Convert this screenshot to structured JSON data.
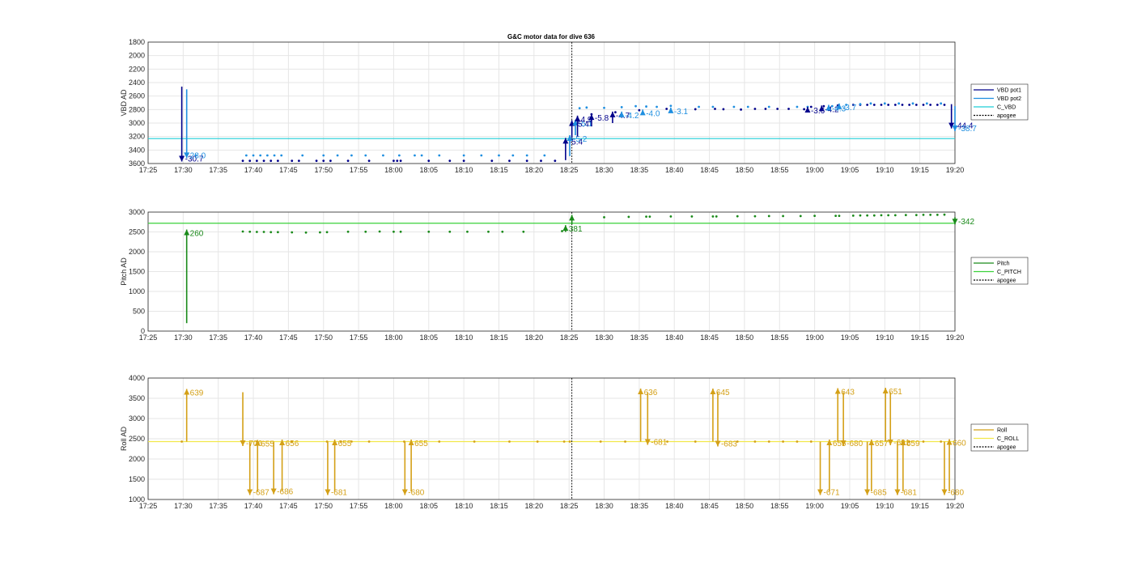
{
  "chart_data": [
    {
      "type": "line",
      "title": "G&C motor data for dive 636",
      "ylabel": "VBD AD",
      "ylim": [
        3600,
        1800
      ],
      "y_reversed": true,
      "yticks": [
        "1800",
        "2000",
        "2200",
        "2400",
        "2600",
        "2800",
        "3000",
        "3200",
        "3400",
        "3600"
      ],
      "xticks": [
        "17:25",
        "17:30",
        "17:35",
        "17:40",
        "17:45",
        "17:50",
        "17:55",
        "18:00",
        "18:05",
        "18:10",
        "18:15",
        "18:20",
        "18:25",
        "18:30",
        "18:35",
        "18:40",
        "18:45",
        "18:50",
        "18:55",
        "19:00",
        "19:05",
        "19:10",
        "19:15",
        "19:20"
      ],
      "xlim_minutes": [
        0,
        115
      ],
      "grid": true,
      "legend_position": "right",
      "legend": [
        {
          "label": "VBD pot1",
          "color": "#00008b",
          "style": "solid"
        },
        {
          "label": "VBD pot2",
          "color": "#1f8fe0",
          "style": "solid"
        },
        {
          "label": "C_VBD",
          "color": "#1fcfd8",
          "style": "solid"
        },
        {
          "label": "apogee",
          "color": "#000000",
          "style": "dotted"
        }
      ],
      "apogee_minute": 60.4,
      "c_value": 3230,
      "pot1_points": [
        [
          13.5,
          3560
        ],
        [
          14.5,
          3560
        ],
        [
          15.5,
          3560
        ],
        [
          16.5,
          3560
        ],
        [
          17.5,
          3560
        ],
        [
          18.5,
          3560
        ],
        [
          20.5,
          3560
        ],
        [
          21.5,
          3560
        ],
        [
          24,
          3560
        ],
        [
          25,
          3560
        ],
        [
          26,
          3560
        ],
        [
          28.5,
          3560
        ],
        [
          31.5,
          3560
        ],
        [
          35,
          3560
        ],
        [
          35.5,
          3560
        ],
        [
          36,
          3560
        ],
        [
          40,
          3560
        ],
        [
          43,
          3560
        ],
        [
          45,
          3560
        ],
        [
          49,
          3560
        ],
        [
          51.5,
          3560
        ],
        [
          54,
          3560
        ],
        [
          56,
          3560
        ],
        [
          58,
          3560
        ],
        [
          63.2,
          2870
        ],
        [
          66.6,
          2840
        ],
        [
          70,
          2810
        ],
        [
          73.9,
          2790
        ],
        [
          78,
          2795
        ],
        [
          80.8,
          2790
        ],
        [
          82,
          2795
        ],
        [
          84.5,
          2800
        ],
        [
          86.5,
          2790
        ],
        [
          88,
          2790
        ],
        [
          89.7,
          2790
        ],
        [
          91.3,
          2790
        ],
        [
          93.5,
          2795
        ],
        [
          94.5,
          2760
        ],
        [
          96.3,
          2750
        ],
        [
          98.3,
          2740
        ],
        [
          100.5,
          2730
        ],
        [
          101.5,
          2730
        ],
        [
          102.5,
          2730
        ],
        [
          103.5,
          2730
        ],
        [
          104.5,
          2730
        ],
        [
          105.5,
          2730
        ],
        [
          106.5,
          2730
        ],
        [
          107.5,
          2730
        ],
        [
          108.5,
          2730
        ],
        [
          109.5,
          2730
        ],
        [
          110.5,
          2730
        ],
        [
          111.5,
          2730
        ],
        [
          112.5,
          2730
        ],
        [
          113.5,
          2730
        ]
      ],
      "pot2_points": [
        [
          6.8,
          3480
        ],
        [
          14,
          3480
        ],
        [
          15,
          3480
        ],
        [
          16,
          3480
        ],
        [
          17,
          3480
        ],
        [
          18,
          3480
        ],
        [
          19,
          3480
        ],
        [
          22,
          3480
        ],
        [
          25,
          3480
        ],
        [
          27,
          3480
        ],
        [
          29,
          3480
        ],
        [
          31,
          3480
        ],
        [
          33.5,
          3480
        ],
        [
          35.8,
          3480
        ],
        [
          38,
          3480
        ],
        [
          39,
          3480
        ],
        [
          41.5,
          3480
        ],
        [
          45,
          3480
        ],
        [
          47.5,
          3480
        ],
        [
          50,
          3480
        ],
        [
          52,
          3480
        ],
        [
          54,
          3480
        ],
        [
          56.5,
          3480
        ],
        [
          61.5,
          2780
        ],
        [
          62.5,
          2770
        ],
        [
          65,
          2775
        ],
        [
          67.5,
          2765
        ],
        [
          69.5,
          2750
        ],
        [
          71,
          2755
        ],
        [
          72.5,
          2760
        ],
        [
          74.5,
          2745
        ],
        [
          78.5,
          2760
        ],
        [
          80.5,
          2760
        ],
        [
          83.5,
          2760
        ],
        [
          85.5,
          2760
        ],
        [
          88.5,
          2760
        ],
        [
          92.5,
          2760
        ],
        [
          94,
          2760
        ],
        [
          97.5,
          2750
        ],
        [
          99.5,
          2730
        ],
        [
          101.5,
          2720
        ],
        [
          103,
          2710
        ],
        [
          105,
          2710
        ],
        [
          107,
          2710
        ],
        [
          109,
          2710
        ],
        [
          111,
          2710
        ],
        [
          113,
          2710
        ]
      ],
      "arrows": [
        {
          "x": 4.8,
          "from": 2460,
          "to": 3570,
          "color": "#00008b",
          "label": "-30.7"
        },
        {
          "x": 5.5,
          "from": 2500,
          "to": 3520,
          "color": "#1f8fe0",
          "label": "28.0"
        },
        {
          "x": 59.5,
          "from": 3550,
          "to": 3220,
          "color": "#00008b",
          "label": "-5.4"
        },
        {
          "x": 60.1,
          "from": 3490,
          "to": 3180,
          "color": "#1f8fe0",
          "label": "-5.2"
        },
        {
          "x": 60.4,
          "from": 3220,
          "to": 2960,
          "color": "#00008b",
          "label": "-5.4"
        },
        {
          "x": 60.9,
          "from": 3180,
          "to": 2950,
          "color": "#1f8fe0",
          "label": "-5.1"
        },
        {
          "x": 61.2,
          "from": 3200,
          "to": 2890,
          "color": "#00008b",
          "label": "4.9"
        },
        {
          "x": 63.2,
          "from": 3050,
          "to": 2870,
          "color": "#00008b",
          "label": "-5.8"
        },
        {
          "x": 66.2,
          "from": 3000,
          "to": 2830,
          "color": "#00008b",
          "label": "-4.7"
        },
        {
          "x": 67.5,
          "from": 2860,
          "to": 2830,
          "color": "#1f8fe0",
          "label": "-4.2"
        },
        {
          "x": 70.5,
          "from": 2830,
          "to": 2800,
          "color": "#1f8fe0",
          "label": "-4.0"
        },
        {
          "x": 74.5,
          "from": 2810,
          "to": 2770,
          "color": "#1f8fe0",
          "label": "-3.1"
        },
        {
          "x": 94,
          "from": 2780,
          "to": 2760,
          "color": "#00008b",
          "label": "-3.6"
        },
        {
          "x": 96,
          "from": 2770,
          "to": 2740,
          "color": "#00008b",
          "label": "-4.2"
        },
        {
          "x": 97,
          "from": 2770,
          "to": 2730,
          "color": "#1f8fe0",
          "label": "-4.3"
        },
        {
          "x": 98.5,
          "from": 2760,
          "to": 2710,
          "color": "#1f8fe0",
          "label": "-3.7"
        },
        {
          "x": 114.5,
          "from": 2720,
          "to": 3080,
          "color": "#00008b",
          "label": "-44.4"
        },
        {
          "x": 115,
          "from": 2750,
          "to": 3120,
          "color": "#1f8fe0",
          "label": "-38.7"
        }
      ]
    },
    {
      "type": "line",
      "title": "",
      "ylabel": "Pitch AD",
      "ylim": [
        0,
        3000
      ],
      "yticks": [
        "0",
        "500",
        "1000",
        "1500",
        "2000",
        "2500",
        "3000"
      ],
      "xticks": [
        "17:25",
        "17:30",
        "17:35",
        "17:40",
        "17:45",
        "17:50",
        "17:55",
        "18:00",
        "18:05",
        "18:10",
        "18:15",
        "18:20",
        "18:25",
        "18:30",
        "18:35",
        "18:40",
        "18:45",
        "18:50",
        "18:55",
        "19:00",
        "19:05",
        "19:10",
        "19:15",
        "19:20"
      ],
      "xlim_minutes": [
        0,
        115
      ],
      "grid": true,
      "legend_position": "right",
      "legend": [
        {
          "label": "Pitch",
          "color": "#1a8a1a",
          "style": "solid"
        },
        {
          "label": "C_PITCH",
          "color": "#3ad13a",
          "style": "solid"
        },
        {
          "label": "apogee",
          "color": "#000000",
          "style": "dotted"
        }
      ],
      "apogee_minute": 60.4,
      "c_value": 2720,
      "points": [
        [
          13.5,
          2510
        ],
        [
          14.5,
          2505
        ],
        [
          15.5,
          2500
        ],
        [
          16.5,
          2500
        ],
        [
          17.5,
          2495
        ],
        [
          18.5,
          2495
        ],
        [
          20.5,
          2490
        ],
        [
          22.5,
          2485
        ],
        [
          24.5,
          2490
        ],
        [
          25.5,
          2495
        ],
        [
          28.5,
          2505
        ],
        [
          31,
          2505
        ],
        [
          33,
          2510
        ],
        [
          35,
          2505
        ],
        [
          36,
          2505
        ],
        [
          40,
          2505
        ],
        [
          43,
          2505
        ],
        [
          45.5,
          2505
        ],
        [
          48.5,
          2505
        ],
        [
          50.5,
          2505
        ],
        [
          53.5,
          2505
        ],
        [
          59,
          2520
        ],
        [
          65,
          2870
        ],
        [
          68.5,
          2880
        ],
        [
          71,
          2885
        ],
        [
          71.5,
          2885
        ],
        [
          74.5,
          2890
        ],
        [
          77.5,
          2890
        ],
        [
          80.5,
          2890
        ],
        [
          81,
          2890
        ],
        [
          84,
          2895
        ],
        [
          86.5,
          2895
        ],
        [
          88.5,
          2900
        ],
        [
          90.5,
          2900
        ],
        [
          93,
          2900
        ],
        [
          95,
          2905
        ],
        [
          98,
          2905
        ],
        [
          98.5,
          2905
        ],
        [
          100.5,
          2910
        ],
        [
          101.5,
          2915
        ],
        [
          102.5,
          2915
        ],
        [
          103.5,
          2915
        ],
        [
          104.5,
          2920
        ],
        [
          105.5,
          2920
        ],
        [
          106.5,
          2920
        ],
        [
          108,
          2925
        ],
        [
          109.5,
          2925
        ],
        [
          110.5,
          2930
        ],
        [
          111.5,
          2930
        ],
        [
          112.5,
          2930
        ],
        [
          113.5,
          2935
        ]
      ],
      "arrows": [
        {
          "x": 5.5,
          "from": 200,
          "to": 2560,
          "label": "260"
        },
        {
          "x": 59.5,
          "from": 2500,
          "to": 2670,
          "label": "381"
        },
        {
          "x": 60.4,
          "from": 2690,
          "to": 2930,
          "label": ""
        },
        {
          "x": 115,
          "from": 2870,
          "to": 2690,
          "label": "-342"
        }
      ]
    },
    {
      "type": "line",
      "title": "",
      "ylabel": "Roll AD",
      "ylim": [
        1000,
        4000
      ],
      "yticks": [
        "1000",
        "1500",
        "2000",
        "2500",
        "3000",
        "3500",
        "4000"
      ],
      "xticks": [
        "17:25",
        "17:30",
        "17:35",
        "17:40",
        "17:45",
        "17:50",
        "17:55",
        "18:00",
        "18:05",
        "18:10",
        "18:15",
        "18:20",
        "18:25",
        "18:30",
        "18:35",
        "18:40",
        "18:45",
        "18:50",
        "18:55",
        "19:00",
        "19:05",
        "19:10",
        "19:15",
        "19:20"
      ],
      "xlim_minutes": [
        0,
        115
      ],
      "grid": true,
      "legend_position": "right",
      "legend": [
        {
          "label": "Roll",
          "color": "#d4a017",
          "style": "solid"
        },
        {
          "label": "C_ROLL",
          "color": "#f2e84a",
          "style": "solid"
        },
        {
          "label": "apogee",
          "color": "#000000",
          "style": "dotted"
        }
      ],
      "apogee_minute": 60.4,
      "c_value": 2430,
      "points": [
        [
          4.8,
          2430
        ],
        [
          15.5,
          2430
        ],
        [
          20.5,
          2430
        ],
        [
          25.5,
          2430
        ],
        [
          27.5,
          2430
        ],
        [
          29,
          2430
        ],
        [
          31.5,
          2430
        ],
        [
          36.5,
          2430
        ],
        [
          41.5,
          2430
        ],
        [
          46.5,
          2430
        ],
        [
          51.5,
          2430
        ],
        [
          55.5,
          2430
        ],
        [
          59.3,
          2430
        ],
        [
          60.1,
          2430
        ],
        [
          64.5,
          2430
        ],
        [
          68,
          2430
        ],
        [
          74,
          2430
        ],
        [
          78,
          2430
        ],
        [
          84,
          2430
        ],
        [
          86.5,
          2430
        ],
        [
          88.5,
          2430
        ],
        [
          90.5,
          2430
        ],
        [
          92.5,
          2430
        ],
        [
          94.5,
          2430
        ],
        [
          108.5,
          2430
        ],
        [
          110.5,
          2430
        ],
        [
          113,
          2430
        ]
      ],
      "arrows": [
        {
          "x": 5.5,
          "from": 2430,
          "to": 3730,
          "label": "639"
        },
        {
          "x": 13.5,
          "from": 3650,
          "to": 2320,
          "label": "-706"
        },
        {
          "x": 14.5,
          "from": 2430,
          "to": 1110,
          "label": "-687"
        },
        {
          "x": 15.6,
          "from": 1200,
          "to": 2470,
          "label": "655"
        },
        {
          "x": 17.9,
          "from": 2430,
          "to": 1130,
          "label": "-686"
        },
        {
          "x": 19.1,
          "from": 1200,
          "to": 2480,
          "label": "656"
        },
        {
          "x": 25.6,
          "from": 2430,
          "to": 1110,
          "label": "-681"
        },
        {
          "x": 26.6,
          "from": 1200,
          "to": 2480,
          "label": "655"
        },
        {
          "x": 36.6,
          "from": 2430,
          "to": 1110,
          "label": "-680"
        },
        {
          "x": 37.5,
          "from": 1200,
          "to": 2480,
          "label": "655"
        },
        {
          "x": 70.2,
          "from": 2430,
          "to": 3740,
          "label": "636"
        },
        {
          "x": 71.2,
          "from": 3650,
          "to": 2350,
          "label": "-681"
        },
        {
          "x": 80.5,
          "from": 2430,
          "to": 3740,
          "label": "645"
        },
        {
          "x": 81.2,
          "from": 3650,
          "to": 2310,
          "label": "-683"
        },
        {
          "x": 95.8,
          "from": 2430,
          "to": 1110,
          "label": "-671"
        },
        {
          "x": 97.1,
          "from": 1200,
          "to": 2480,
          "label": "655"
        },
        {
          "x": 98.3,
          "from": 2430,
          "to": 3750,
          "label": "643"
        },
        {
          "x": 99.1,
          "from": 3650,
          "to": 2320,
          "label": "-680"
        },
        {
          "x": 102.5,
          "from": 2430,
          "to": 1110,
          "label": "-685"
        },
        {
          "x": 103.1,
          "from": 1200,
          "to": 2480,
          "label": "657"
        },
        {
          "x": 105.1,
          "from": 2430,
          "to": 3760,
          "label": "651"
        },
        {
          "x": 105.8,
          "from": 3650,
          "to": 2340,
          "label": "-691"
        },
        {
          "x": 106.8,
          "from": 2430,
          "to": 1110,
          "label": "-681"
        },
        {
          "x": 107.6,
          "from": 1200,
          "to": 2480,
          "label": "659"
        },
        {
          "x": 113.5,
          "from": 2430,
          "to": 1110,
          "label": "-680"
        },
        {
          "x": 114.2,
          "from": 1200,
          "to": 2490,
          "label": "660"
        }
      ]
    }
  ]
}
